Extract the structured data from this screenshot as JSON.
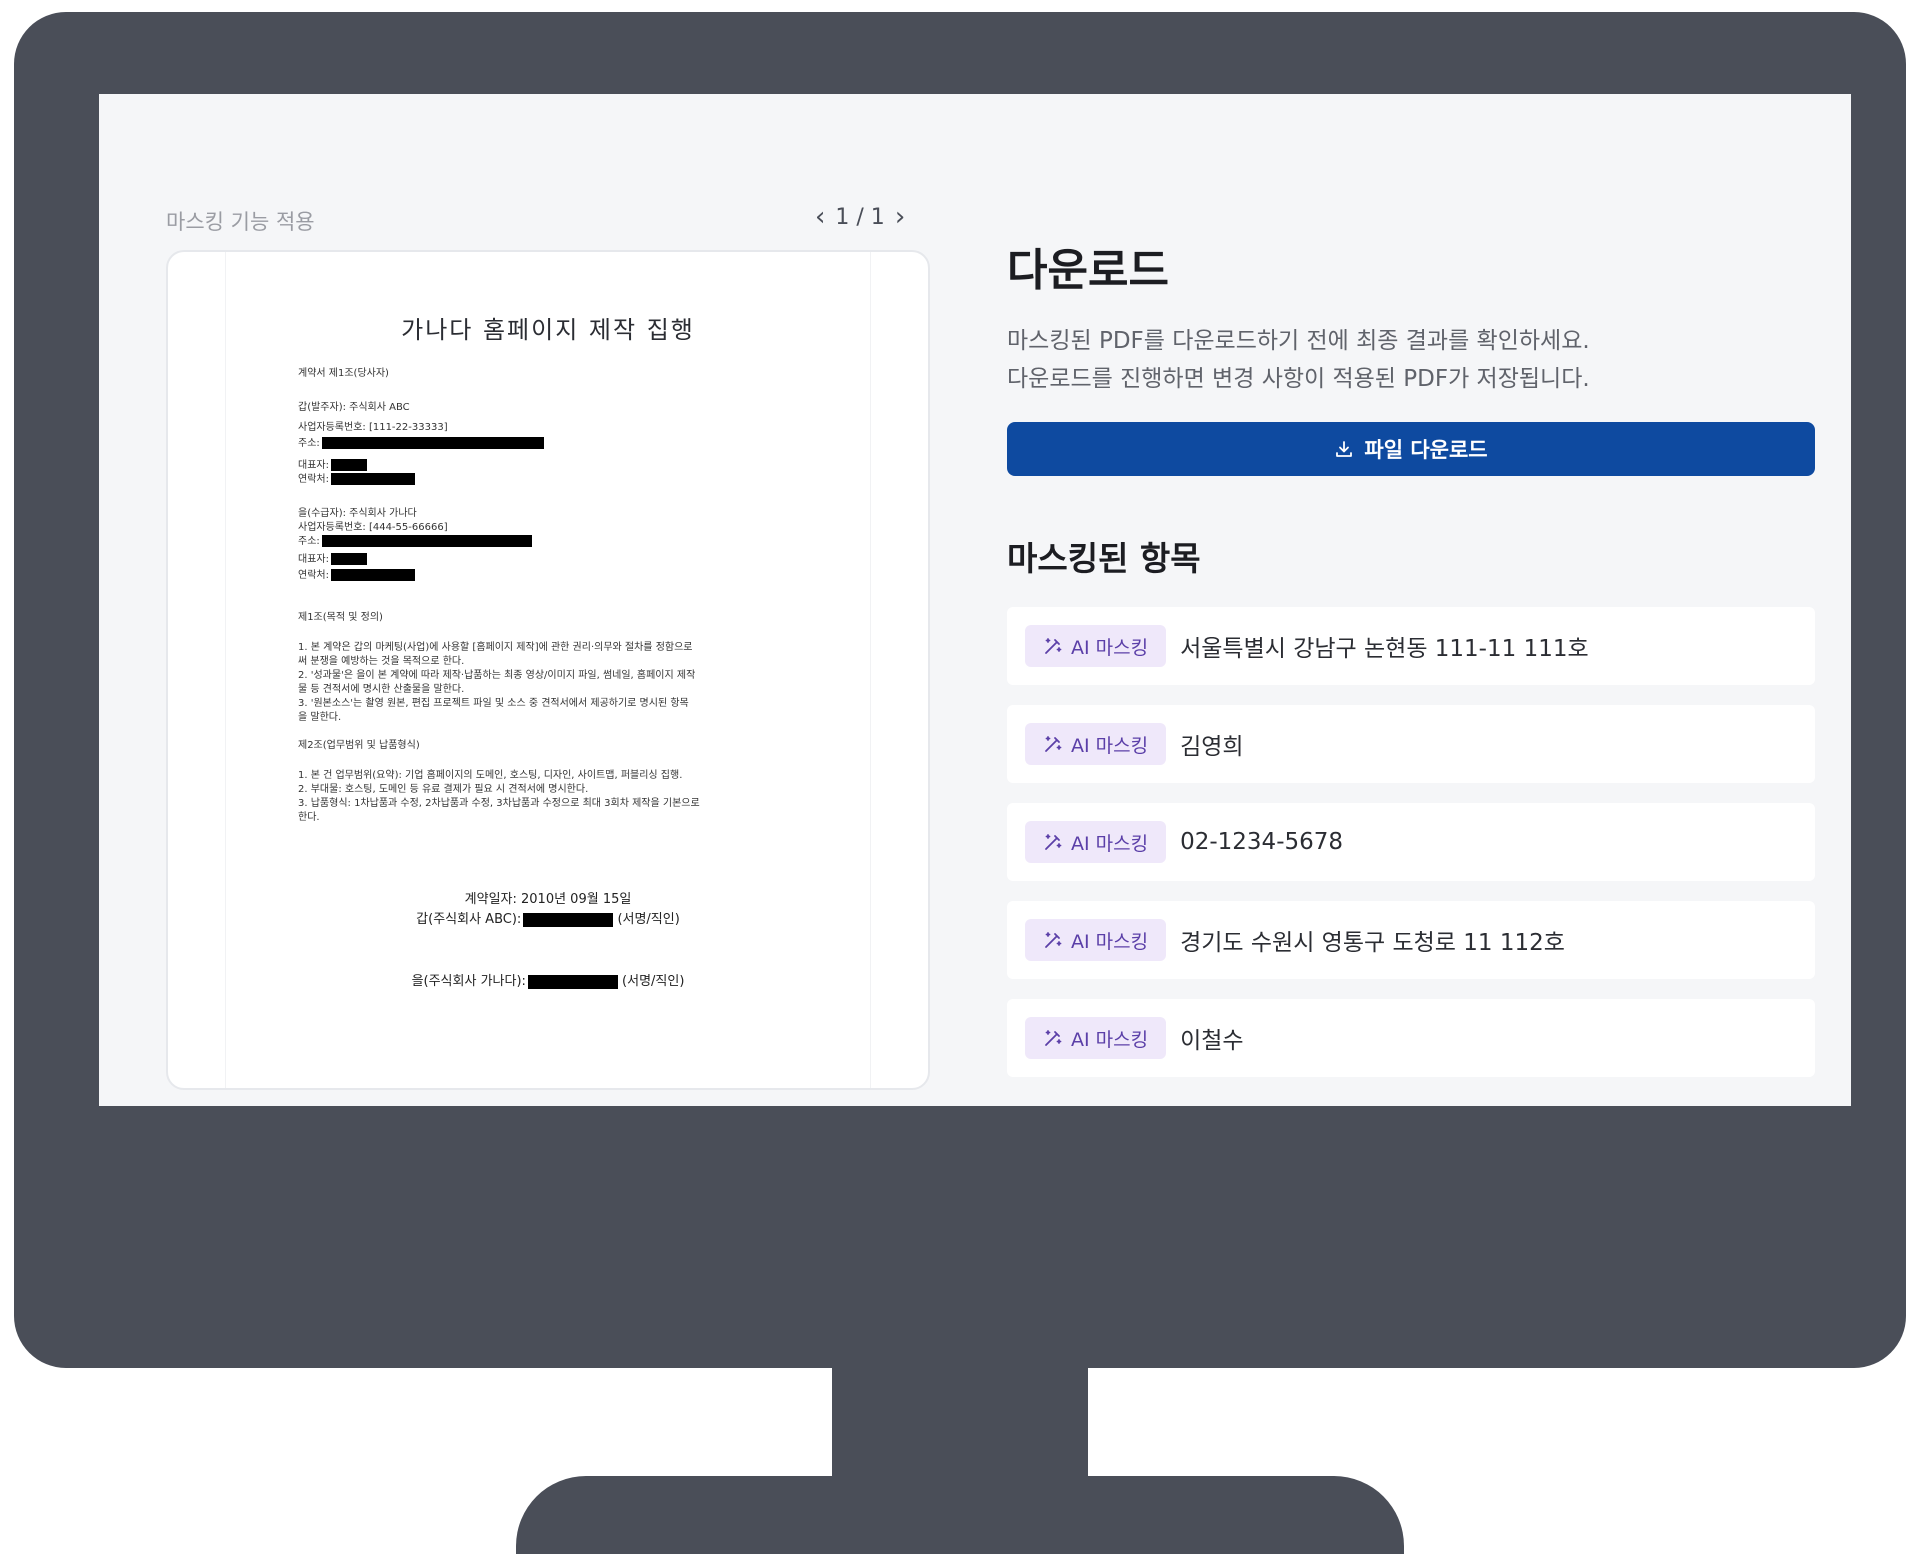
{
  "preview": {
    "label": "마스킹 기능 적용",
    "pager": {
      "prev": "‹",
      "text": "1 / 1",
      "next": "›"
    }
  },
  "document": {
    "title": "가나다 홈페이지 제작 집행",
    "lines": [
      "계약서 제1조(당사자)",
      "갑(발주자): 주식회사 ABC",
      "사업자등록번호: [111-22-33333]",
      "주소:",
      "대표자:",
      "연락처:",
      "을(수급자): 주식회사 가나다",
      "사업자등록번호: [444-55-66666]",
      "주소:",
      "대표자:",
      "연락처:",
      "제1조(목적 및 정의)",
      "1. 본 계약은 갑의 마케팅(사업)에 사용할 [홈페이지 제작]에 관한 권리·의무와 절차를 정함으로",
      "   써 분쟁을 예방하는 것을 목적으로 한다.",
      "2. '성과물'은 을이 본 계약에 따라 제작·납품하는 최종 영상/이미지 파일, 썸네일, 홈페이지 제작",
      "   물 등 견적서에 명시한 산출물을 말한다.",
      "3. '원본소스'는 촬영 원본, 편집 프로젝트 파일 및 소스 중 견적서에서 제공하기로 명시된 항목",
      "   을 말한다.",
      "제2조(업무범위 및 납품형식)",
      "1. 본 건 업무범위(요약): 기업 홈페이지의 도메인, 호스팅, 디자인, 사이트맵, 퍼블리싱 집행.",
      "2. 부대물: 호스팅, 도메인 등 유료 결제가 필요 시 견적서에 명시한다.",
      "3. 납품형식: 1차납품과 수정, 2차납품과 수정, 3차납품과 수정으로 최대 3회차 제작을 기본으로",
      "   한다."
    ],
    "contract_date": "계약일자: 2010년 09월 15일",
    "sign_a_prefix": "갑(주식회사 ABC):",
    "sign_b_prefix": "을(주식회사 가나다):",
    "sign_suffix": "(서명/직인)"
  },
  "download": {
    "title": "다운로드",
    "desc_line1": "마스킹된 PDF를 다운로드하기 전에 최종 결과를 확인하세요.",
    "desc_line2": "다운로드를 진행하면 변경 사항이 적용된 PDF가 저장됩니다.",
    "button_label": "파일 다운로드"
  },
  "masked": {
    "title": "마스킹된 항목",
    "badge_label": "AI 마스킹",
    "items": [
      "서울특별시 강남구 논현동 111-11 111호",
      "김영희",
      "02-1234-5678",
      "경기도 수원시 영통구 도청로 11 112호",
      "이철수"
    ]
  },
  "colors": {
    "frame": "#4a4e58",
    "button": "#0e4aa0",
    "badge_bg": "#efe8fa",
    "badge_text": "#5b3fa8"
  }
}
